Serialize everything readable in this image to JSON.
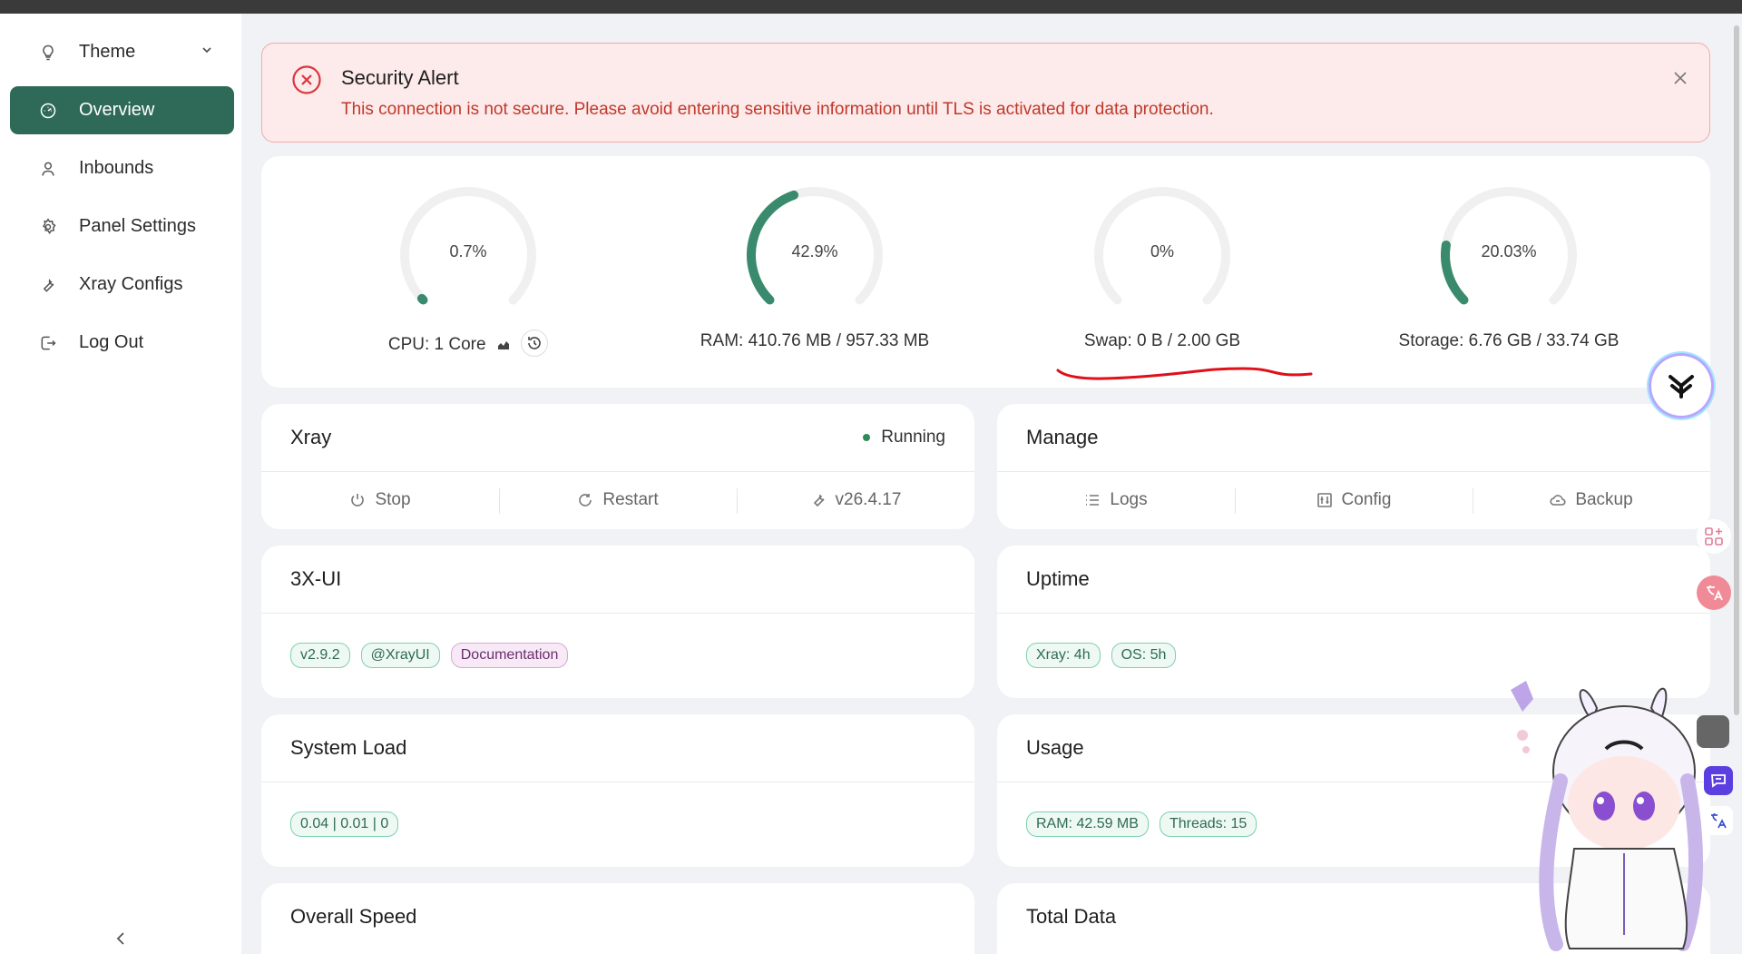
{
  "sidebar": {
    "items": [
      {
        "label": "Theme",
        "icon": "lightbulb-icon"
      },
      {
        "label": "Overview",
        "icon": "dashboard-icon",
        "active": true
      },
      {
        "label": "Inbounds",
        "icon": "user-icon"
      },
      {
        "label": "Panel Settings",
        "icon": "gear-icon"
      },
      {
        "label": "Xray Configs",
        "icon": "wrench-icon"
      },
      {
        "label": "Log Out",
        "icon": "logout-icon"
      }
    ]
  },
  "alert": {
    "title": "Security Alert",
    "message": "This connection is not secure. Please avoid entering sensitive information until TLS is activated for data protection."
  },
  "gauges": [
    {
      "value_text": "0.7%",
      "percent": 0.7,
      "label": "CPU: 1 Core"
    },
    {
      "value_text": "42.9%",
      "percent": 42.9,
      "label": "RAM: 410.76 MB / 957.33 MB"
    },
    {
      "value_text": "0%",
      "percent": 0,
      "label": "Swap: 0 B / 2.00 GB"
    },
    {
      "value_text": "20.03%",
      "percent": 20.03,
      "label": "Storage: 6.76 GB / 33.74 GB"
    }
  ],
  "xray": {
    "title": "Xray",
    "status": "Running",
    "actions": [
      "Stop",
      "Restart",
      "v26.4.17"
    ]
  },
  "manage": {
    "title": "Manage",
    "actions": [
      "Logs",
      "Config",
      "Backup"
    ]
  },
  "threexui": {
    "title": "3X-UI",
    "tags": [
      "v2.9.2",
      "@XrayUI",
      "Documentation"
    ]
  },
  "uptime": {
    "title": "Uptime",
    "tags": [
      "Xray: 4h",
      "OS: 5h"
    ]
  },
  "system_load": {
    "title": "System Load",
    "tags": [
      "0.04 | 0.01 | 0"
    ]
  },
  "usage": {
    "title": "Usage",
    "tags": [
      "RAM: 42.59 MB",
      "Threads: 15"
    ]
  },
  "overall_speed": {
    "title": "Overall Speed"
  },
  "total_data": {
    "title": "Total Data"
  },
  "colors": {
    "accent": "#2e6a57",
    "gauge_fill": "#3a8a6e",
    "gauge_track": "#f0f0f0",
    "alert_bg": "#fdeaea",
    "alert_text": "#c0392b",
    "annotation": "#e0101a"
  }
}
